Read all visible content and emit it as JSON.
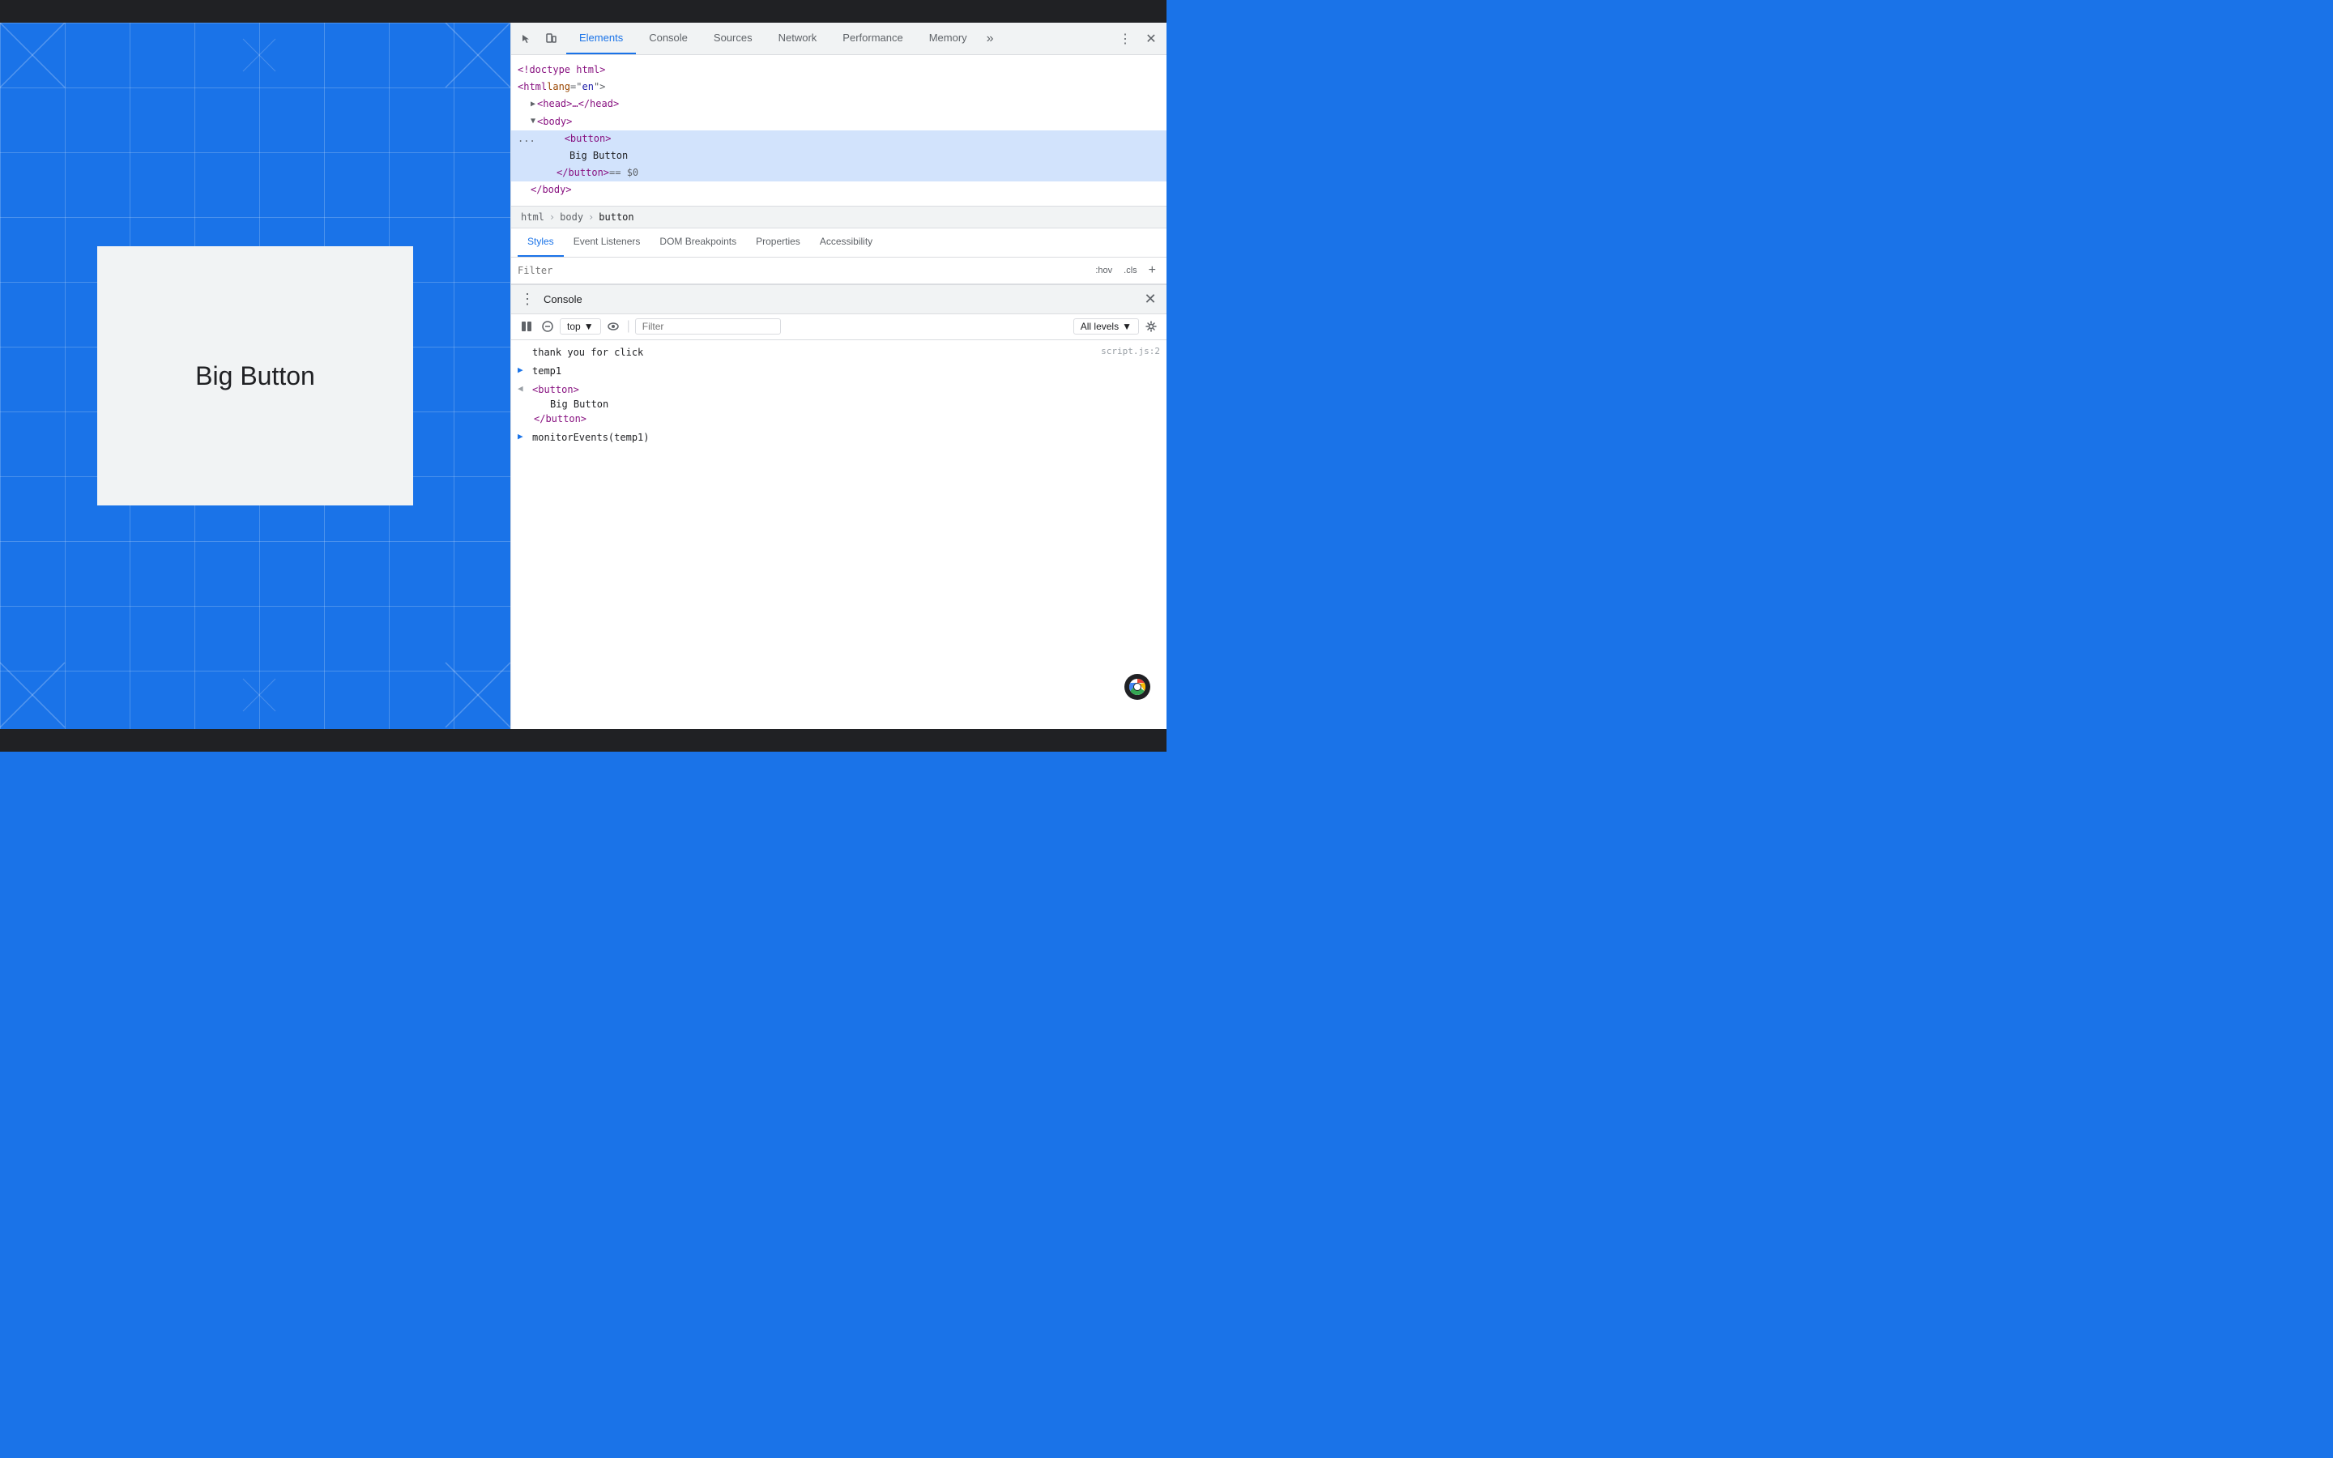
{
  "chromeTopBar": {
    "height": 28
  },
  "webpage": {
    "bigButtonText": "Big Button"
  },
  "devtools": {
    "tabs": [
      {
        "id": "elements",
        "label": "Elements",
        "active": true
      },
      {
        "id": "console",
        "label": "Console",
        "active": false
      },
      {
        "id": "sources",
        "label": "Sources",
        "active": false
      },
      {
        "id": "network",
        "label": "Network",
        "active": false
      },
      {
        "id": "performance",
        "label": "Performance",
        "active": false
      },
      {
        "id": "memory",
        "label": "Memory",
        "active": false
      }
    ],
    "toolbar": {
      "overflowLabel": "»",
      "moreOptionsLabel": "⋮",
      "closeLabel": "✕"
    },
    "htmlTree": {
      "lines": [
        {
          "indent": 0,
          "content": "<!doctype html>",
          "type": "doctype"
        },
        {
          "indent": 0,
          "content": "<html lang=\"en\">",
          "type": "open-tag"
        },
        {
          "indent": 1,
          "content": "<head>…</head>",
          "type": "collapsed",
          "toggle": "▶"
        },
        {
          "indent": 1,
          "content": "<body>",
          "type": "open-tag",
          "toggle": "▼"
        },
        {
          "indent": 2,
          "content": "<button>",
          "type": "selected-open"
        },
        {
          "indent": 3,
          "content": "Big Button",
          "type": "text"
        },
        {
          "indent": 3,
          "content": "</button> == $0",
          "type": "selected-close"
        },
        {
          "indent": 1,
          "content": "</body>",
          "type": "close-tag"
        }
      ]
    },
    "breadcrumb": {
      "items": [
        {
          "id": "html",
          "label": "html"
        },
        {
          "id": "body",
          "label": "body"
        },
        {
          "id": "button",
          "label": "button",
          "active": true
        }
      ]
    },
    "panelTabs": {
      "tabs": [
        {
          "id": "styles",
          "label": "Styles",
          "active": true
        },
        {
          "id": "event-listeners",
          "label": "Event Listeners",
          "active": false
        },
        {
          "id": "dom-breakpoints",
          "label": "DOM Breakpoints",
          "active": false
        },
        {
          "id": "properties",
          "label": "Properties",
          "active": false
        },
        {
          "id": "accessibility",
          "label": "Accessibility",
          "active": false
        }
      ]
    },
    "filter": {
      "placeholder": "Filter",
      "hovLabel": ":hov",
      "clsLabel": ".cls",
      "addLabel": "+"
    },
    "consoleDrawer": {
      "title": "Console",
      "toolbar": {
        "contextValue": "top",
        "filterPlaceholder": "Filter",
        "levelValue": "All levels"
      },
      "output": [
        {
          "type": "log",
          "arrow": "",
          "text": "thank you for click",
          "link": "script.js:2"
        },
        {
          "type": "expand",
          "arrow": "▶",
          "text": "temp1",
          "link": ""
        },
        {
          "type": "arrow-left",
          "arrow": "◀",
          "lines": [
            "<button>",
            "    Big Button",
            "</button>"
          ],
          "link": ""
        },
        {
          "type": "expand",
          "arrow": "▶",
          "text": "monitorEvents(temp1)",
          "link": ""
        }
      ]
    }
  }
}
